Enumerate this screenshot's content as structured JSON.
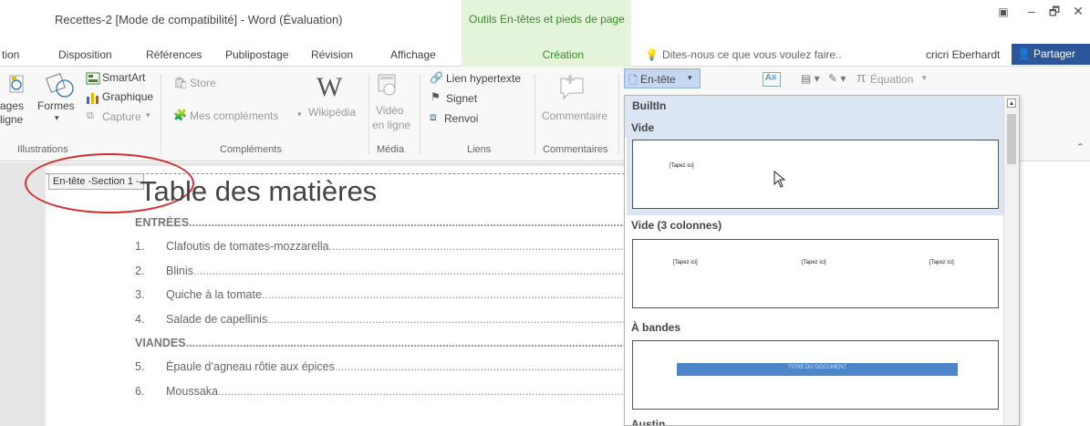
{
  "window": {
    "title": "Recettes-2 [Mode de compatibilité] - Word (Évaluation)",
    "context_tools": "Outils En-têtes et pieds de page",
    "restore_icon": "ribbon-display-options-icon",
    "minimize": "–",
    "maximize": "🗗",
    "close": "✕"
  },
  "tabs": {
    "insertion": "tion",
    "disposition": "Disposition",
    "references": "Références",
    "publipostage": "Publipostage",
    "revision": "Révision",
    "affichage": "Affichage",
    "creation": "Création"
  },
  "tell_me": {
    "placeholder": "Dites-nous ce que vous voulez faire.."
  },
  "user": {
    "name": "cricri Eberhardt"
  },
  "share": {
    "label": "Partager"
  },
  "ribbon": {
    "illustrations": {
      "images_line1": "ages",
      "images_line2": "ligne",
      "formes": "Formes",
      "smartart": "SmartArt",
      "graphique": "Graphique",
      "capture": "Capture",
      "label": "Illustrations"
    },
    "complements": {
      "store": "Store",
      "mes_complements": "Mes compléments",
      "wikipedia": "Wikipédia",
      "label": "Compléments"
    },
    "media": {
      "video_line1": "Vidéo",
      "video_line2": "en ligne",
      "label": "Média"
    },
    "liens": {
      "lien_hypertexte": "Lien hypertexte",
      "signet": "Signet",
      "renvoi": "Renvoi",
      "label": "Liens"
    },
    "commentaires": {
      "commentaire": "Commentaire",
      "label": "Commentaires"
    },
    "entete_pied": {
      "entete": "En-tête",
      "equation": "Équation"
    }
  },
  "document": {
    "header_tag": "En-tête -Section 1 -",
    "toc_title": "Table des matières",
    "toc": [
      {
        "type": "section",
        "text": "ENTRÉES"
      },
      {
        "type": "item",
        "num": "1.",
        "text": "Clafoutis de tomates-mozzarella"
      },
      {
        "type": "item",
        "num": "2.",
        "text": "Blinis"
      },
      {
        "type": "item",
        "num": "3.",
        "text": "Quiche à la tomate"
      },
      {
        "type": "item",
        "num": "4.",
        "text": "Salade de capellinis"
      },
      {
        "type": "section",
        "text": "VIANDES"
      },
      {
        "type": "item",
        "num": "5.",
        "text": "Épaule d’agneau rôtie aux épices"
      },
      {
        "type": "item",
        "num": "6.",
        "text": "Moussaka"
      }
    ]
  },
  "gallery": {
    "category": "BuiltIn",
    "items": [
      {
        "name": "Vide",
        "placeholders": [
          "[Tapez ici]"
        ]
      },
      {
        "name": "Vide (3 colonnes)",
        "placeholders": [
          "[Tapez ici]",
          "[Tapez ici]",
          "[Tapez ici]"
        ]
      },
      {
        "name": "À bandes",
        "placeholders": [
          "TITRE DU DOCUMENT"
        ]
      },
      {
        "name": "Austin",
        "placeholders": []
      }
    ]
  },
  "colors": {
    "accent": "#2b579a",
    "context_green": "#3a8a2a",
    "context_bg": "#e4f4da",
    "annotation_red": "#d52f2f",
    "gallery_highlight": "#dbe6f4"
  }
}
